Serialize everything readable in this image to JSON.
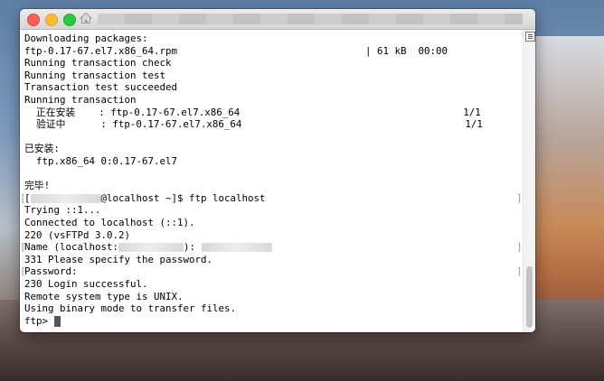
{
  "window": {
    "title_redacted": true
  },
  "terminal": {
    "lines": [
      {
        "text": "Downloading packages:"
      },
      {
        "text": "ftp-0.17-67.el7.x86_64.rpm                                | 61 kB  00:00"
      },
      {
        "text": "Running transaction check"
      },
      {
        "text": "Running transaction test"
      },
      {
        "text": "Transaction test succeeded"
      },
      {
        "text": "Running transaction"
      },
      {
        "text": "  正在安装    : ftp-0.17-67.el7.x86_64                                      1/1"
      },
      {
        "text": "  验证中      : ftp-0.17-67.el7.x86_64                                      1/1"
      },
      {
        "text": ""
      },
      {
        "text": "已安装:"
      },
      {
        "text": "  ftp.x86_64 0:0.17-67.el7"
      },
      {
        "text": ""
      },
      {
        "text": "完毕!"
      }
    ],
    "prompt_line": {
      "prefix": "[",
      "suffix": "@localhost ~]$ ftp localhost"
    },
    "lines2": [
      {
        "text": "Trying ::1..."
      },
      {
        "text": "Connected to localhost (::1)."
      },
      {
        "text": "220 (vsFTPd 3.0.2)"
      }
    ],
    "name_line": {
      "prefix": "Name (localhost:",
      "middle": "): "
    },
    "lines3": [
      {
        "text": "331 Please specify the password."
      },
      {
        "text": "Password:"
      },
      {
        "text": "230 Login successful."
      },
      {
        "text": "Remote system type is UNIX."
      },
      {
        "text": "Using binary mode to transfer files."
      }
    ],
    "ftp_prompt": "ftp> "
  }
}
